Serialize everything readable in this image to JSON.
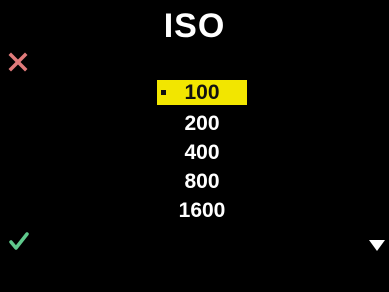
{
  "screen": {
    "title": "ISO"
  },
  "controls": {
    "cancel_icon": "x-icon",
    "cancel_color": "#e07a7a",
    "confirm_icon": "check-icon",
    "confirm_color": "#5fc98c",
    "scroll_icon": "chevron-down-icon",
    "scroll_color": "#ffffff"
  },
  "iso_options": {
    "items": [
      {
        "label": "100",
        "selected": true
      },
      {
        "label": "200",
        "selected": false
      },
      {
        "label": "400",
        "selected": false
      },
      {
        "label": "800",
        "selected": false
      },
      {
        "label": "1600",
        "selected": false
      }
    ],
    "highlight_color": "#f2e600"
  }
}
